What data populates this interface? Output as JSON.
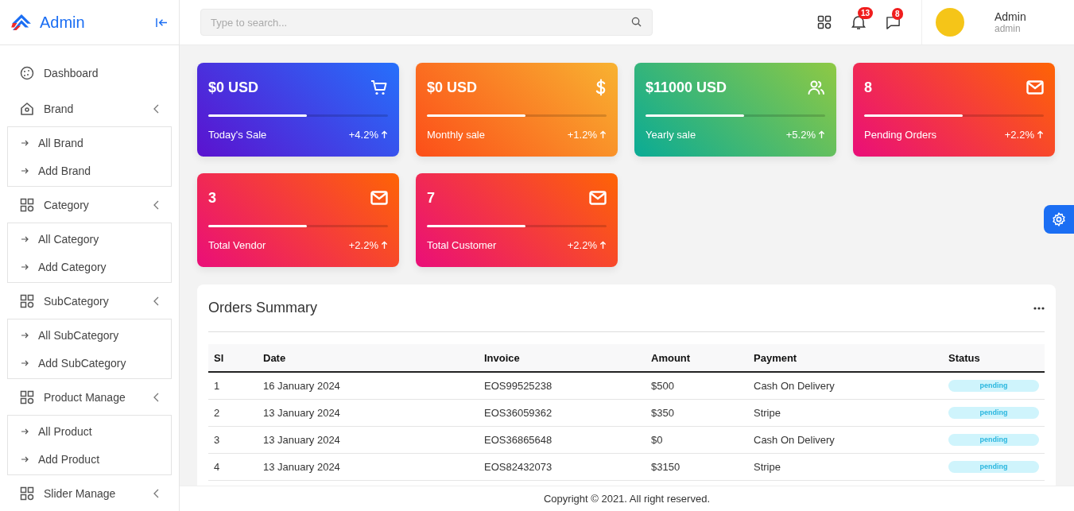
{
  "brand": {
    "name": "Admin"
  },
  "sidebar": {
    "items": [
      {
        "label": "Dashboard",
        "kind": "link"
      },
      {
        "label": "Brand",
        "kind": "group",
        "expanded": true,
        "children": [
          {
            "label": "All Brand"
          },
          {
            "label": "Add Brand"
          }
        ]
      },
      {
        "label": "Category",
        "kind": "group",
        "expanded": true,
        "children": [
          {
            "label": "All Category"
          },
          {
            "label": "Add Category"
          }
        ]
      },
      {
        "label": "SubCategory",
        "kind": "group",
        "expanded": true,
        "children": [
          {
            "label": "All SubCategory"
          },
          {
            "label": "Add SubCategory"
          }
        ]
      },
      {
        "label": "Product Manage",
        "kind": "group",
        "expanded": true,
        "children": [
          {
            "label": "All Product"
          },
          {
            "label": "Add Product"
          }
        ]
      },
      {
        "label": "Slider Manage",
        "kind": "group",
        "expanded": false
      }
    ]
  },
  "search": {
    "placeholder": "Type to search..."
  },
  "header": {
    "notifications": "13",
    "messages": "8",
    "user": {
      "name": "Admin",
      "role": "admin"
    }
  },
  "cards": [
    {
      "kind": "cart",
      "value": "$0 USD",
      "label": "Today's Sale",
      "change": "+4.2%",
      "level": 0.55
    },
    {
      "kind": "money",
      "value": "$0 USD",
      "label": "Monthly sale",
      "change": "+1.2%",
      "level": 0.55
    },
    {
      "kind": "people",
      "value": "$11000 USD",
      "label": "Yearly sale",
      "change": "+5.2%",
      "level": 0.55
    },
    {
      "kind": "mail",
      "value": "8",
      "label": "Pending Orders",
      "change": "+2.2%",
      "level": 0.55
    },
    {
      "kind": "mail",
      "value": "3",
      "label": "Total Vendor",
      "change": "+2.2%",
      "level": 0.55
    },
    {
      "kind": "mail",
      "value": "7",
      "label": "Total Customer",
      "change": "+2.2%",
      "level": 0.55
    }
  ],
  "orders": {
    "title": "Orders Summary",
    "columns": [
      "Sl",
      "Date",
      "Invoice",
      "Amount",
      "Payment",
      "Status"
    ],
    "rows": [
      [
        "1",
        "16 January 2024",
        "EOS99525238",
        "$500",
        "Cash On Delivery",
        "pending"
      ],
      [
        "2",
        "13 January 2024",
        "EOS36059362",
        "$350",
        "Stripe",
        "pending"
      ],
      [
        "3",
        "13 January 2024",
        "EOS36865648",
        "$0",
        "Cash On Delivery",
        "pending"
      ],
      [
        "4",
        "13 January 2024",
        "EOS82432073",
        "$3150",
        "Stripe",
        "pending"
      ]
    ]
  },
  "footer": "Copyright © 2021. All right reserved."
}
